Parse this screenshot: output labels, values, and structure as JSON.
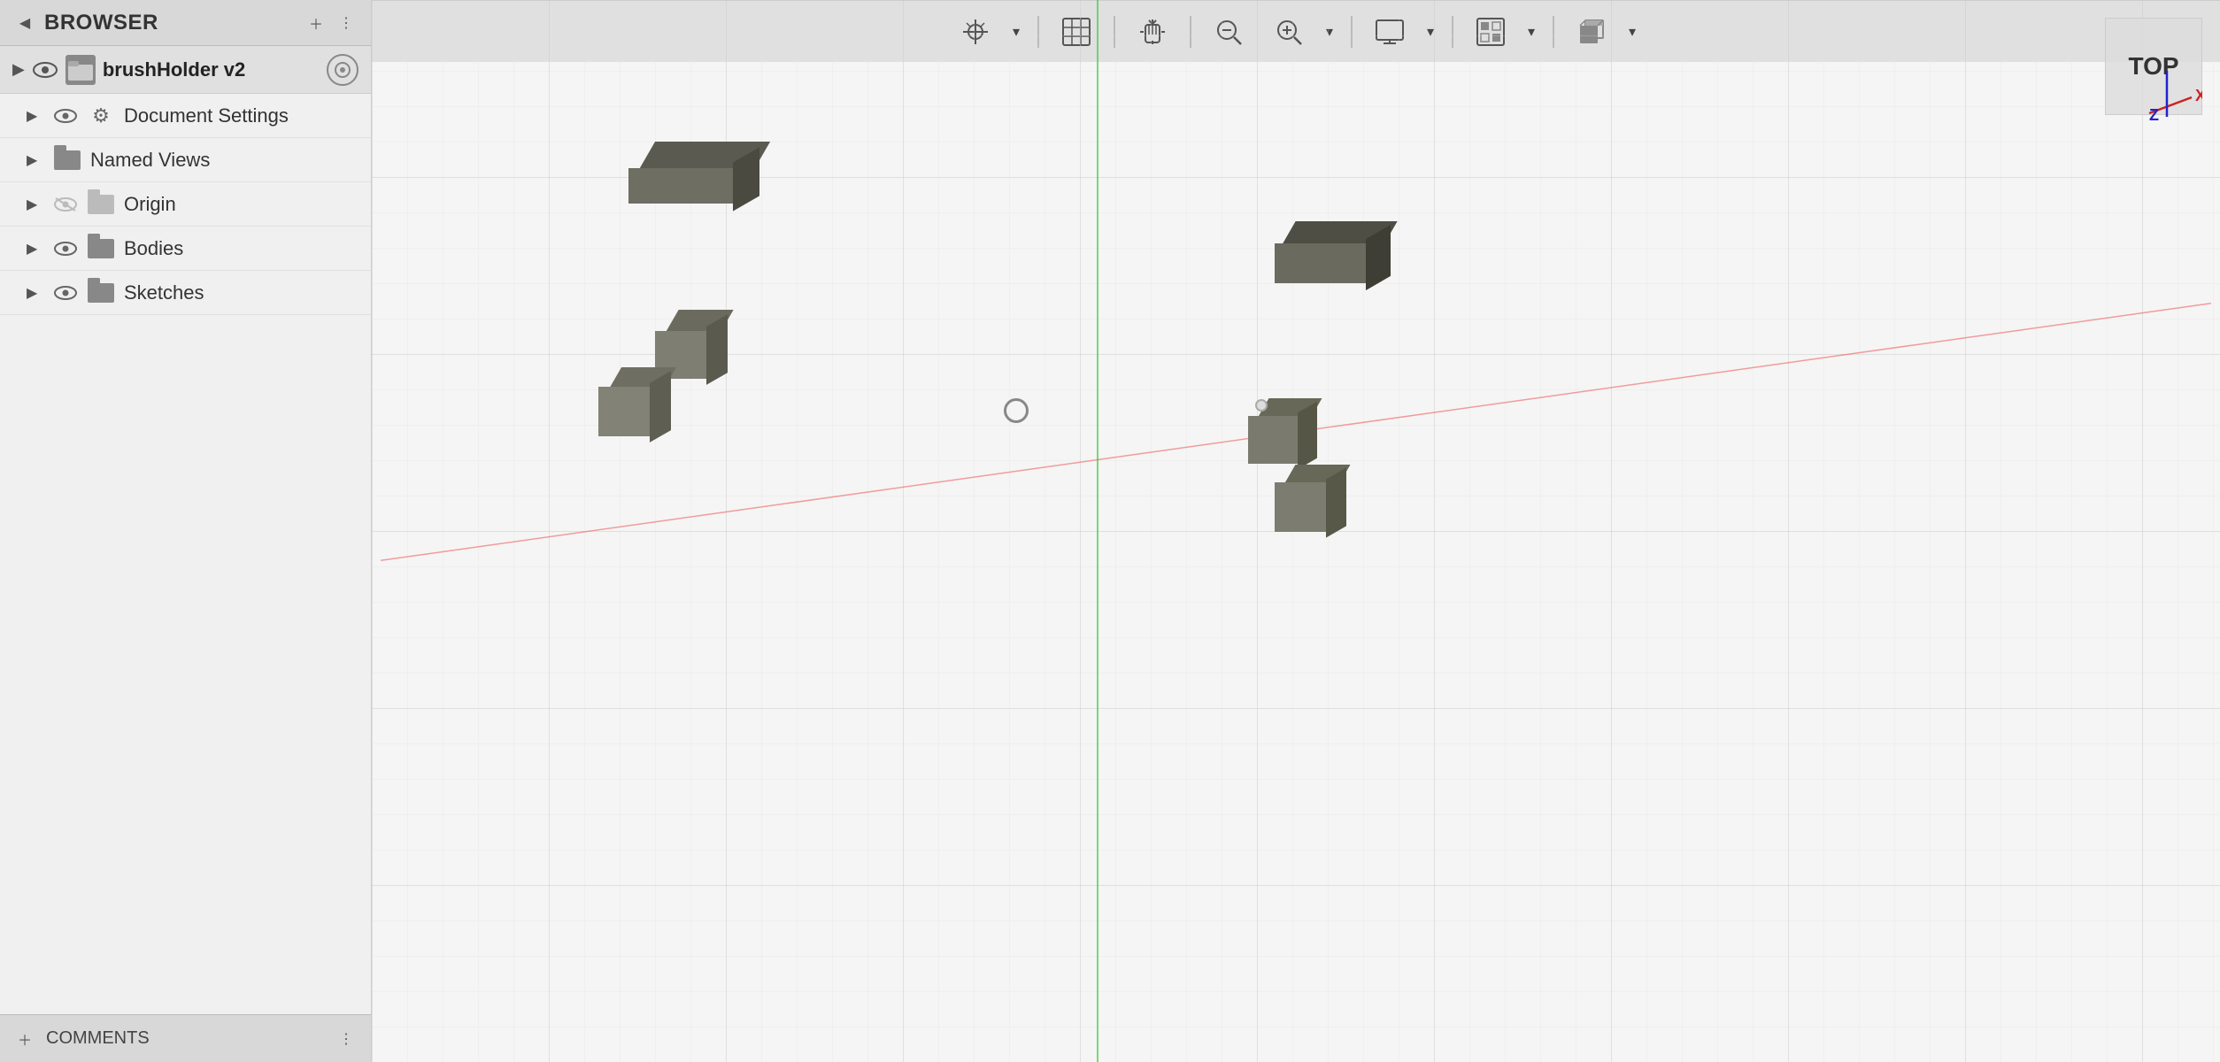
{
  "browser": {
    "title": "BROWSER",
    "collapse_btn": "◀",
    "split_btn": "⋮"
  },
  "document": {
    "name": "brushHolder v2",
    "items": [
      {
        "label": "Document Settings",
        "type": "settings",
        "visible": true
      },
      {
        "label": "Named Views",
        "type": "folder",
        "visible": true
      },
      {
        "label": "Origin",
        "type": "folder",
        "visible": false
      },
      {
        "label": "Bodies",
        "type": "folder",
        "visible": true
      },
      {
        "label": "Sketches",
        "type": "folder",
        "visible": true
      }
    ]
  },
  "comments": {
    "label": "COMMENTS"
  },
  "viewport": {
    "view_label": "TOP",
    "axis_x": "X",
    "axis_z": "Z"
  },
  "toolbar": {
    "buttons": [
      {
        "id": "origin",
        "icon": "⊕",
        "label": "Origin"
      },
      {
        "id": "grid",
        "icon": "▦",
        "label": "Grid"
      },
      {
        "id": "pan",
        "icon": "✋",
        "label": "Pan"
      },
      {
        "id": "zoom-fit",
        "icon": "⊗",
        "label": "Zoom Fit"
      },
      {
        "id": "zoom",
        "icon": "🔍",
        "label": "Zoom"
      },
      {
        "id": "display",
        "icon": "🖥",
        "label": "Display"
      },
      {
        "id": "grid-visibility",
        "icon": "⊞",
        "label": "Grid Visibility"
      },
      {
        "id": "view-cube",
        "icon": "⬛",
        "label": "View Cube"
      }
    ]
  }
}
